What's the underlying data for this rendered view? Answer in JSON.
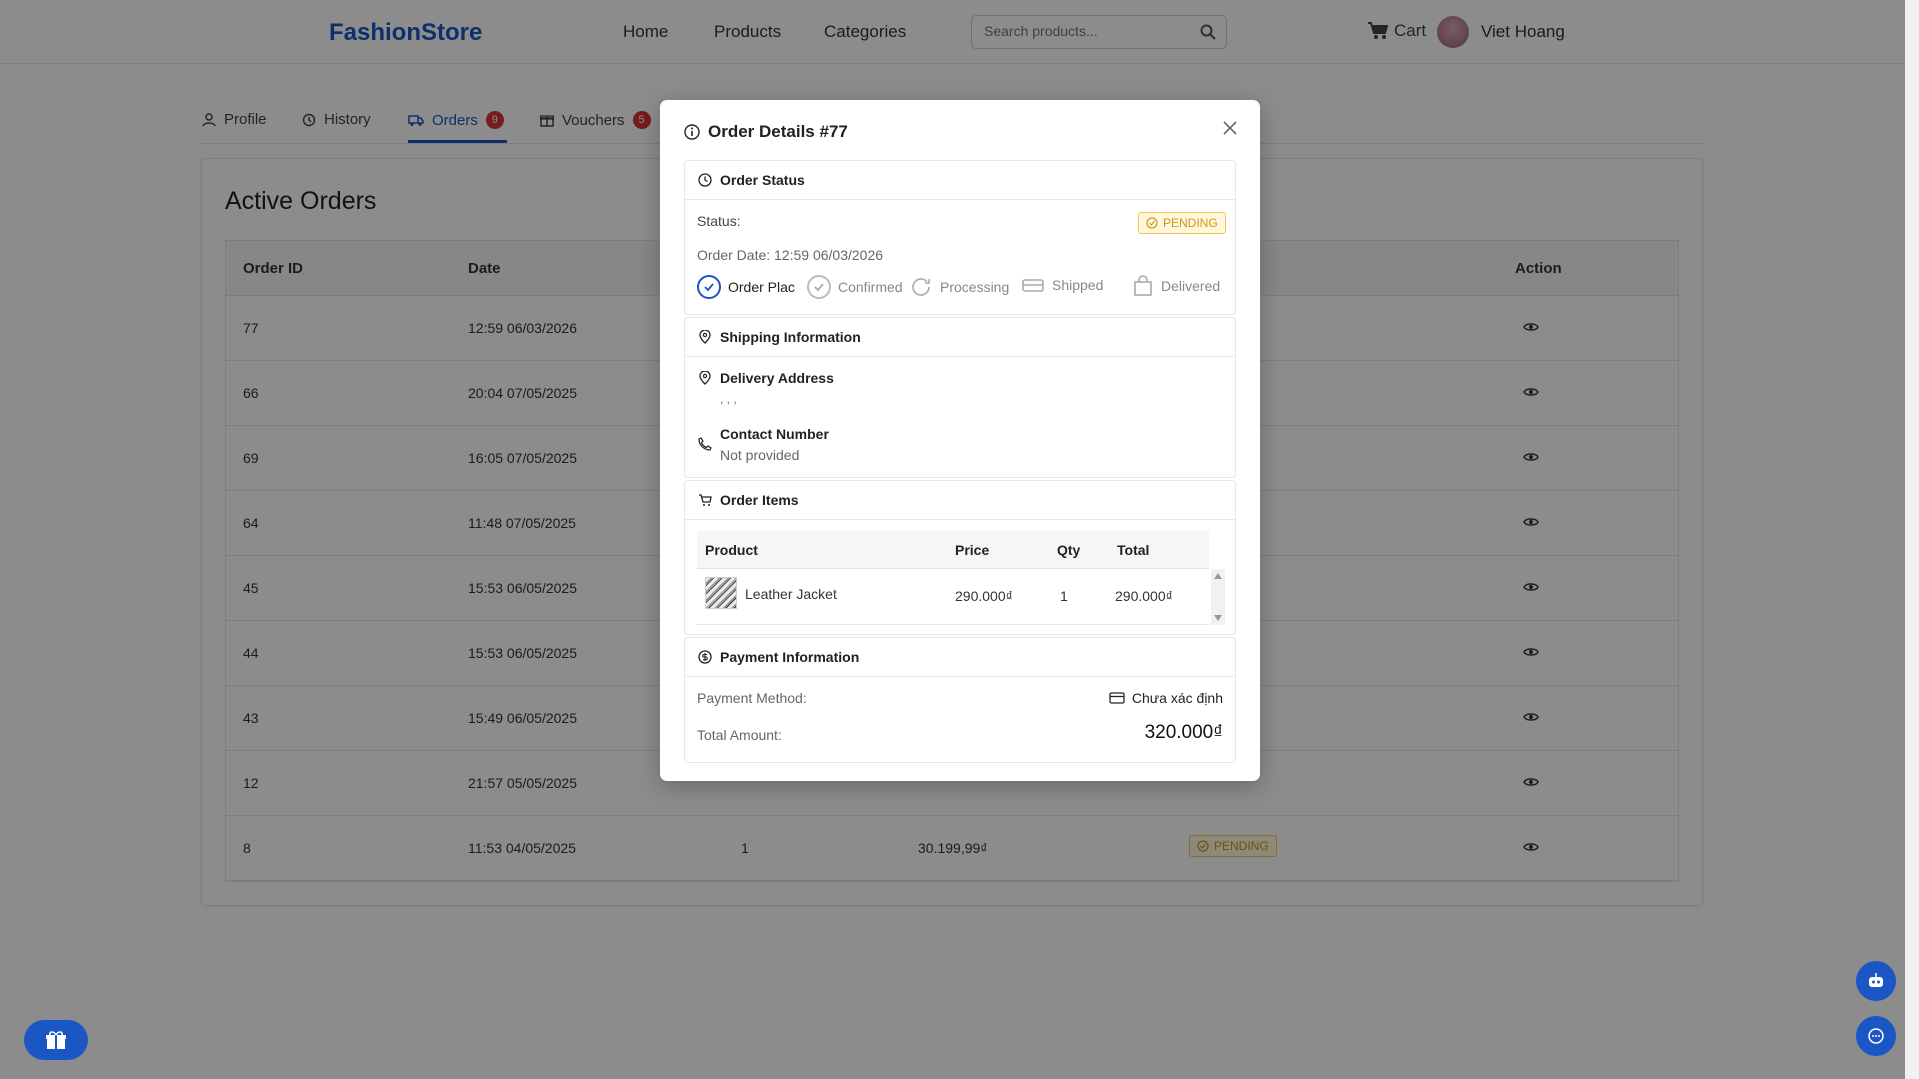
{
  "header": {
    "brand": "FashionStore",
    "nav": [
      "Home",
      "Products",
      "Categories"
    ],
    "search_placeholder": "Search products...",
    "cart_label": "Cart",
    "user_name": "Viet Hoang"
  },
  "tabs": [
    {
      "label": "Profile"
    },
    {
      "label": "History"
    },
    {
      "label": "Orders",
      "badge": "9"
    },
    {
      "label": "Vouchers",
      "badge": "5"
    }
  ],
  "orders_page": {
    "title": "Active Orders",
    "columns": [
      "Order ID",
      "Date",
      "Action"
    ],
    "rows": [
      {
        "id": "77",
        "date": "12:59 06/03/2026"
      },
      {
        "id": "66",
        "date": "20:04 07/05/2025"
      },
      {
        "id": "69",
        "date": "16:05 07/05/2025"
      },
      {
        "id": "64",
        "date": "11:48 07/05/2025"
      },
      {
        "id": "45",
        "date": "15:53 06/05/2025"
      },
      {
        "id": "44",
        "date": "15:53 06/05/2025"
      },
      {
        "id": "43",
        "date": "15:49 06/05/2025"
      },
      {
        "id": "12",
        "date": "21:57 05/05/2025"
      },
      {
        "id": "8",
        "date": "11:53 04/05/2025",
        "qty": "1",
        "total": "30.199,99₫",
        "status": "PENDING"
      }
    ]
  },
  "modal": {
    "title": "Order Details #77",
    "status_section": {
      "title": "Order Status",
      "status_label": "Status:",
      "status_value": "PENDING",
      "order_date": "Order Date: 12:59 06/03/2026",
      "steps": [
        "Order Plac",
        "Confirmed",
        "Processing",
        "Shipped",
        "Delivered"
      ]
    },
    "shipping_section": {
      "title": "Shipping Information",
      "address_label": "Delivery Address",
      "address_value": ", , ,",
      "contact_label": "Contact Number",
      "contact_value": "Not provided"
    },
    "items_section": {
      "title": "Order Items",
      "columns": [
        "Product",
        "Price",
        "Qty",
        "Total"
      ],
      "items": [
        {
          "product": "Leather Jacket",
          "price": "290.000₫",
          "qty": "1",
          "total": "290.000₫"
        }
      ]
    },
    "payment_section": {
      "title": "Payment Information",
      "method_label": "Payment Method:",
      "method_value": "Chưa xác định",
      "total_label": "Total Amount:",
      "total_value": "320.000₫"
    }
  },
  "colors": {
    "brand": "#1a56c4",
    "badge": "#d63333",
    "pending": "#c99a12"
  }
}
